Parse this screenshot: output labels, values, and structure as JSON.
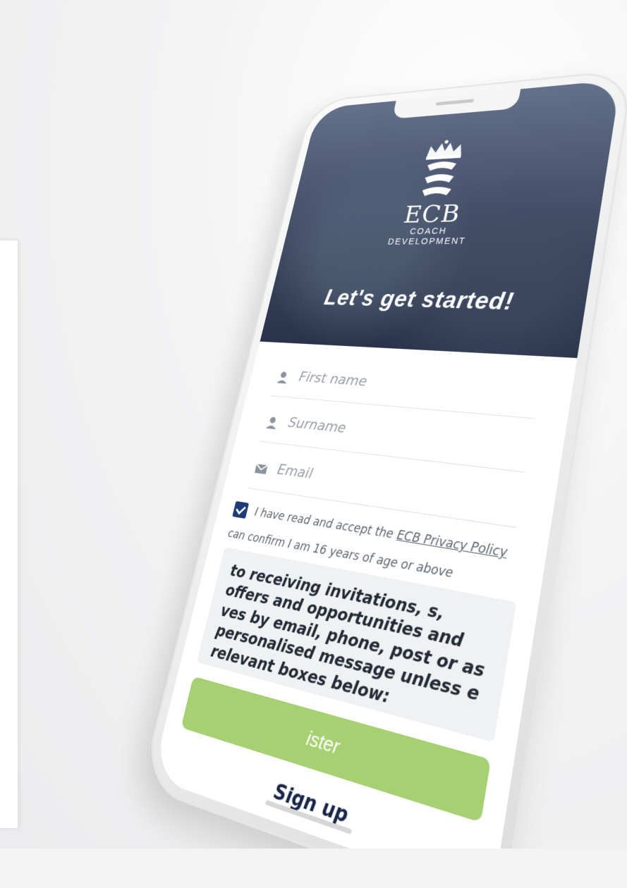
{
  "header": {
    "logo_text": "ECB",
    "logo_line1": "COACH",
    "logo_line2": "DEVELOPMENT",
    "headline": "Let's get started!"
  },
  "form": {
    "first_name_placeholder": "First name",
    "surname_placeholder": "Surname",
    "email_placeholder": "Email",
    "checkbox1_text": "I have read and accept the",
    "privacy_link": "ECB Privacy Policy",
    "checkbox2_text": "can confirm I am 16 years of age or above",
    "consent_text": "to receiving invitations, s, offers and opportunities and ves by email, phone, post or as personalised message unless e relevant boxes below:",
    "register_label": "ister",
    "signup_label": "Sign up"
  },
  "icons": {
    "first_name": "user-icon",
    "surname": "user-icon",
    "email": "envelope-icon",
    "checkbox": "checkbox-checked-icon"
  },
  "colors": {
    "hero_bg": "#3f4b66",
    "checkbox": "#1f3c76",
    "register": "#a7d073",
    "signup": "#17254a"
  }
}
